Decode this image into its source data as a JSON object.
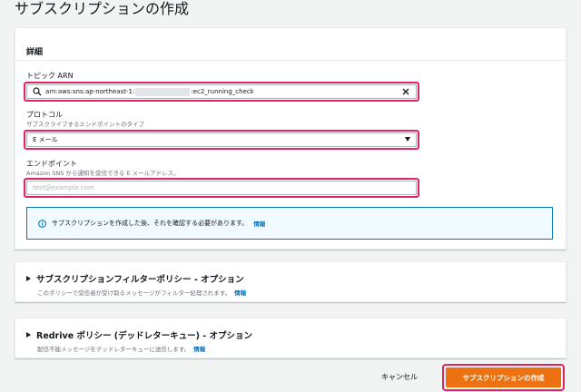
{
  "page": {
    "title": "サブスクリプションの作成"
  },
  "details": {
    "heading": "詳細",
    "topic_arn": {
      "label": "トピック ARN",
      "prefix": "arn:aws:sns:ap-northeast-1:",
      "suffix": ":ec2_running_check"
    },
    "protocol": {
      "label": "プロトコル",
      "sub": "サブスクライブするエンドポイントのタイプ",
      "value": "E メール"
    },
    "endpoint": {
      "label": "エンドポイント",
      "sub": "Amazon SNS から通知を受信できる E メールアドレス。",
      "placeholder": "test@example.com"
    },
    "info": {
      "text": "サブスクリプションを作成した後、それを確認する必要があります。",
      "link": "情報"
    }
  },
  "filter_policy": {
    "title": "サブスクリプションフィルターポリシー - オプション",
    "sub": "このポリシーで受信者が受け取るメッセージがフィルター処理されます。",
    "link": "情報"
  },
  "redrive_policy": {
    "title": "Redrive ポリシー (デッドレターキュー) - オプション",
    "sub": "配信不能メッセージをデッドレターキューに送信します。",
    "link": "情報"
  },
  "actions": {
    "cancel": "キャンセル",
    "create": "サブスクリプションの作成"
  },
  "colors": {
    "primary_button": "#ec7211",
    "highlight": "#e0245e",
    "link": "#0073bb",
    "info_bg": "#f1faff"
  }
}
